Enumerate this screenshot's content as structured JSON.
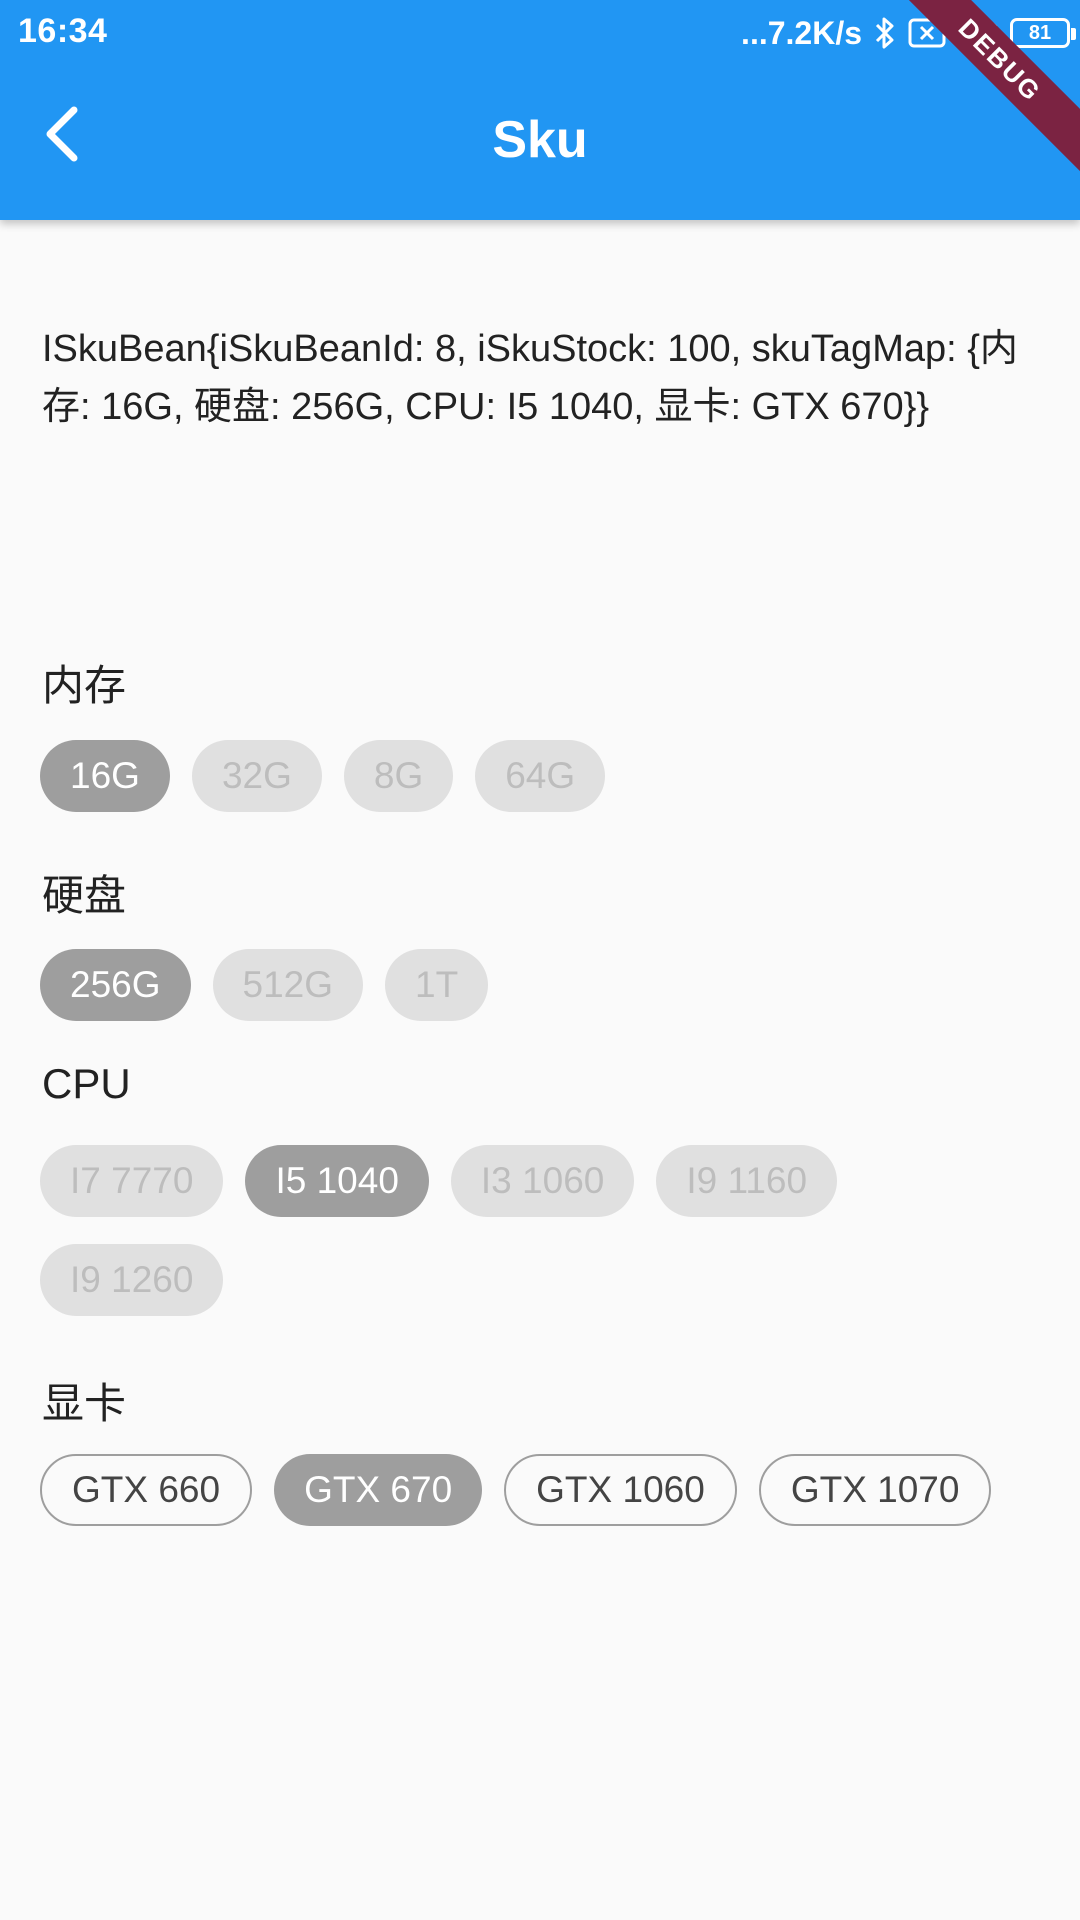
{
  "status_bar": {
    "time": "16:34",
    "network_speed": "...7.2K/s",
    "battery_level": "81",
    "icons": [
      "bluetooth-icon",
      "sim-off-icon",
      "wifi-icon",
      "battery-icon"
    ]
  },
  "app_bar": {
    "title": "Sku",
    "back_icon": "arrow-back-icon",
    "debug_banner": "DEBUG",
    "color": "#2196f3"
  },
  "sku_info": "ISkuBean{iSkuBeanId: 8, iSkuStock: 100, skuTagMap: {内存: 16G, 硬盘: 256G, CPU: I5 1040, 显卡: GTX 670}}",
  "groups": [
    {
      "label": "内存",
      "options": [
        {
          "label": "16G",
          "state": "selected"
        },
        {
          "label": "32G",
          "state": "disabled"
        },
        {
          "label": "8G",
          "state": "disabled"
        },
        {
          "label": "64G",
          "state": "disabled"
        }
      ]
    },
    {
      "label": "硬盘",
      "options": [
        {
          "label": "256G",
          "state": "selected"
        },
        {
          "label": "512G",
          "state": "disabled"
        },
        {
          "label": "1T",
          "state": "disabled"
        }
      ]
    },
    {
      "label": "CPU",
      "options": [
        {
          "label": "I7 7770",
          "state": "disabled"
        },
        {
          "label": "I5 1040",
          "state": "selected"
        },
        {
          "label": "I3 1060",
          "state": "disabled"
        },
        {
          "label": "I9 1160",
          "state": "disabled"
        },
        {
          "label": "I9 1260",
          "state": "disabled"
        }
      ]
    },
    {
      "label": "显卡",
      "options": [
        {
          "label": "GTX 660",
          "state": "available"
        },
        {
          "label": "GTX 670",
          "state": "selected"
        },
        {
          "label": "GTX 1060",
          "state": "available"
        },
        {
          "label": "GTX 1070",
          "state": "available"
        }
      ]
    }
  ],
  "colors": {
    "selected": "#9e9e9e",
    "disabled": "#e0e0e0",
    "outline": "#9e9e9e",
    "background": "#fafafa"
  }
}
